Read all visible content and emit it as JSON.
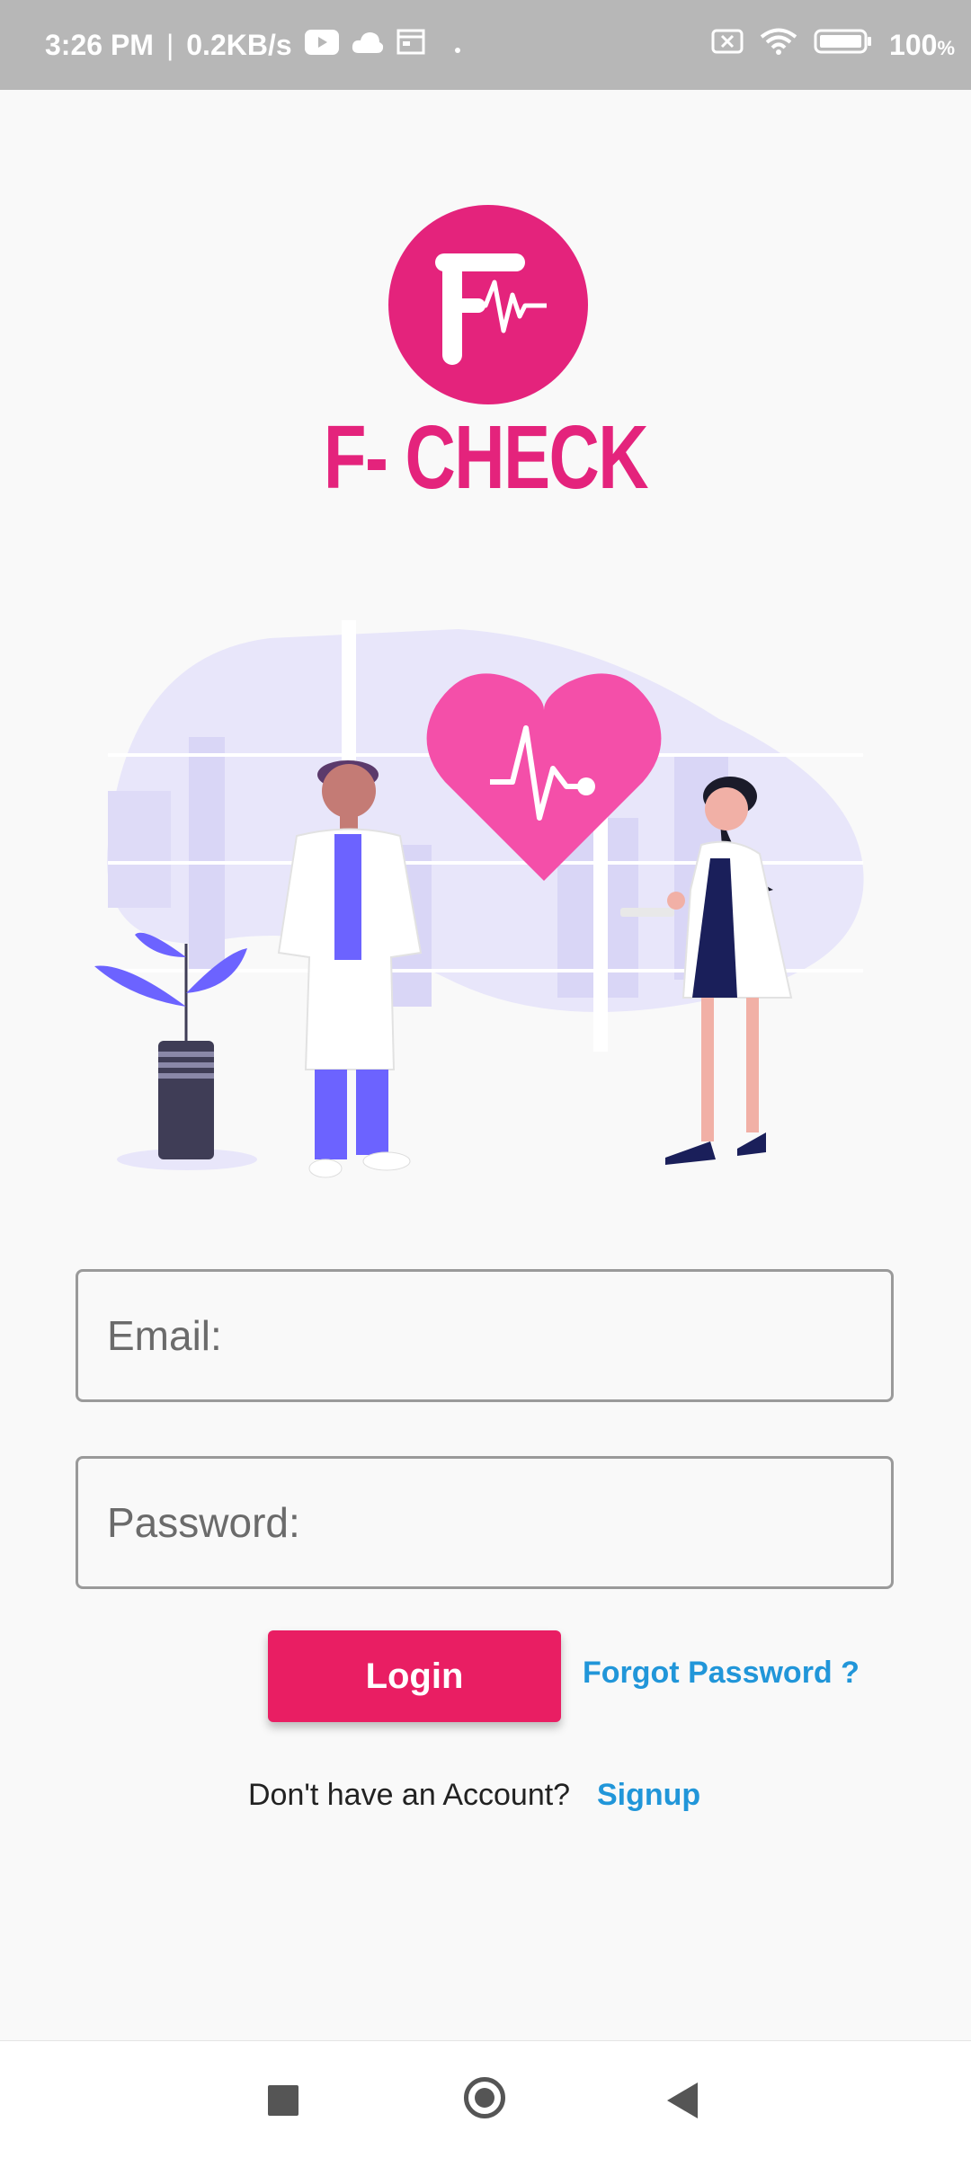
{
  "status_bar": {
    "time": "3:26 PM",
    "speed": "0.2KB/s",
    "battery": "100",
    "icons": [
      "youtube-icon",
      "cloud-icon",
      "calendar-icon",
      "dot-icon",
      "sim-off-icon",
      "wifi-icon",
      "battery-icon"
    ]
  },
  "app": {
    "title": "F- CHECK",
    "brand_color": "#e4237c"
  },
  "form": {
    "email_placeholder": "Email:",
    "email_value": "",
    "password_placeholder": "Password:",
    "password_value": "",
    "login_label": "Login",
    "forgot_label": "Forgot Password ?",
    "no_account_label": "Don't have an Account?",
    "signup_label": "Signup"
  },
  "colors": {
    "accent": "#e91e63",
    "link": "#2196d9",
    "illustration_purple": "#6c63ff"
  }
}
